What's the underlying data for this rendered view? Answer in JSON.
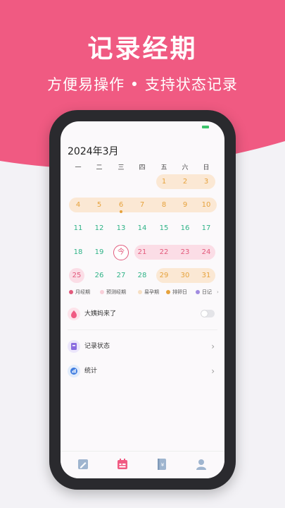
{
  "header": {
    "title": "记录经期",
    "subtitle": "方便易操作 • 支持状态记录"
  },
  "calendar": {
    "month_title": "2024年3月",
    "weekdays": [
      "一",
      "二",
      "三",
      "四",
      "五",
      "六",
      "日"
    ],
    "weeks": [
      [
        "",
        "",
        "",
        "",
        "1",
        "2",
        "3"
      ],
      [
        "4",
        "5",
        "6",
        "7",
        "8",
        "9",
        "10"
      ],
      [
        "11",
        "12",
        "13",
        "14",
        "15",
        "16",
        "17"
      ],
      [
        "18",
        "19",
        "今",
        "21",
        "22",
        "23",
        "24"
      ],
      [
        "25",
        "26",
        "27",
        "28",
        "29",
        "30",
        "31"
      ]
    ]
  },
  "legend": {
    "items": [
      "月经期",
      "预测经期",
      "易孕期",
      "排卵日",
      "日记"
    ],
    "more": "›"
  },
  "rows": {
    "period_toggle": "大姨妈来了",
    "record_status": "记录状态",
    "statistics": "统计",
    "chevron": "›"
  },
  "colors": {
    "brand_pink": "#f05a82",
    "period_pink": "#e25a7c",
    "fertile_orange": "#e6a23c",
    "normal_green": "#2fb387"
  },
  "tabbar": {
    "icons": [
      "pen-icon",
      "calendar-icon",
      "notebook-icon",
      "profile-icon"
    ]
  }
}
